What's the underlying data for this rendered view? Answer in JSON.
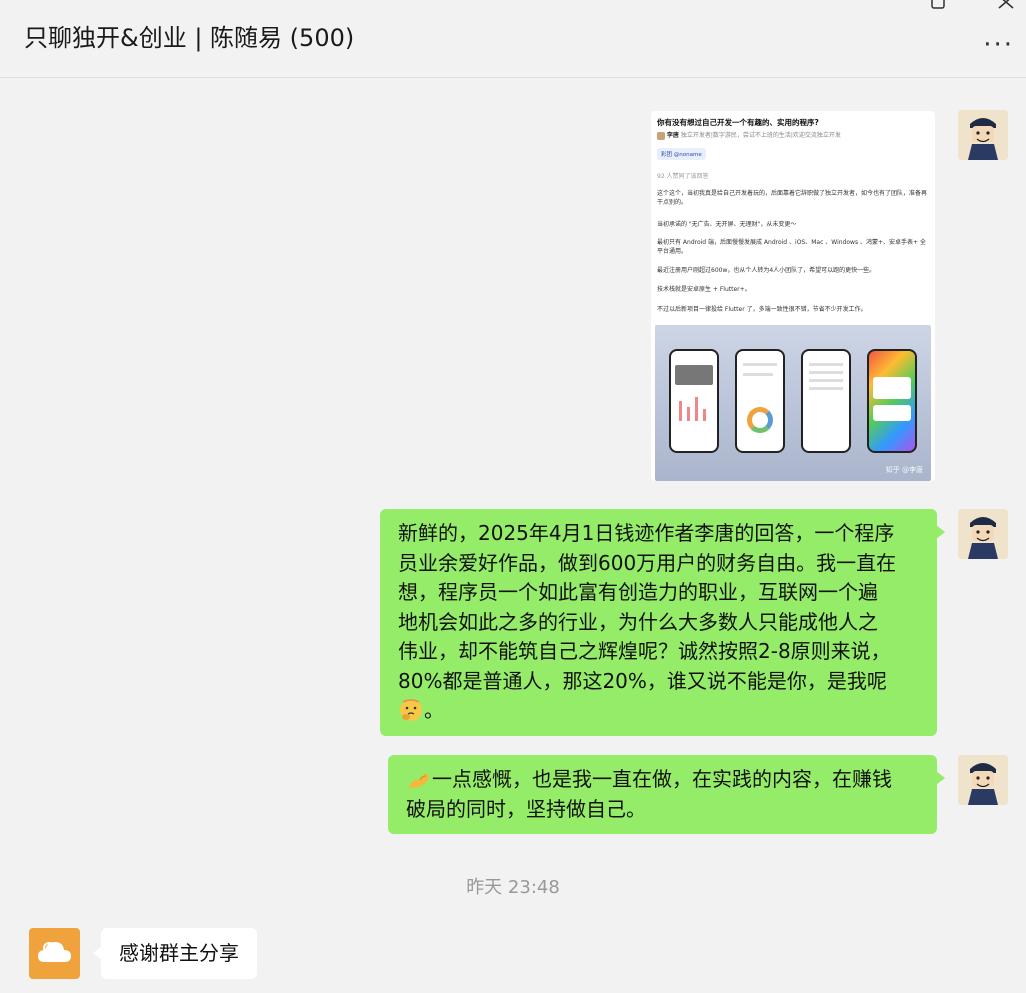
{
  "window": {
    "title": "只聊独开&创业 | 陈随易 (500)",
    "more_label": "···"
  },
  "messages": {
    "image_card": {
      "question": "你有没有想过自己开发一个有趣的、实用的程序?",
      "author_name": "李唐",
      "author_desc": "独立开发者|数字游民，尝试不上班的生活|欢迎交流独立开发",
      "tag": "彩团 @noname",
      "upvotes": "92 人赞同了该回答",
      "paragraphs": [
        "这个这个，当初我真是给自己开发着玩的，后面靠着它辞职做了独立开发者，如今也有了团队，准备再干点别的。",
        "当初承诺的 \"无广告、无开屏、无理财\"，从未变更～",
        "最初只有 Android 端，后面慢慢发展成 Android 、iOS、Mac 、Windows 、鸿蒙+、安卓手表+ 全平台通用。",
        "最近注册用户刚超过600w，也从个人转为4人小团队了，希望可以跑的更快一些。",
        "技术栈就是安卓原生 + Flutter+。",
        "不过以后新项目一律投给 Flutter 了，多端一致性很不错，节省不少开发工作。"
      ],
      "watermark": "知乎 @李唐"
    },
    "bubble_1": {
      "lines": [
        "新鲜的，2025年4月1日钱迹作者李唐的回答，一个程序",
        "员业余爱好作品，做到600万用户的财务自由。我一直在",
        "想，程序员一个如此富有创造力的职业，互联网一个遍",
        "地机会如此之多的行业，为什么大多数人只能成他人之",
        "伟业，却不能筑自己之辉煌呢？诚然按照2-8原则来说，",
        "80%都是普通人，那这20%，谁又说不能是你，是我呢"
      ],
      "tail": "。",
      "emoji": "thinking-face-icon"
    },
    "bubble_2": {
      "line_1": "一点感慨，也是我一直在做，在实践的内容，在赚钱",
      "line_2": "破局的同时，坚持做自己。",
      "emoji": "flexed-arm-icon"
    },
    "timestamp": "昨天 23:48",
    "reply": {
      "text": "感谢群主分享"
    }
  },
  "colors": {
    "self_bubble": "#95ec69",
    "other_bubble": "#ffffff",
    "background": "#f2f2f2",
    "other_avatar": "#f0a23c"
  }
}
